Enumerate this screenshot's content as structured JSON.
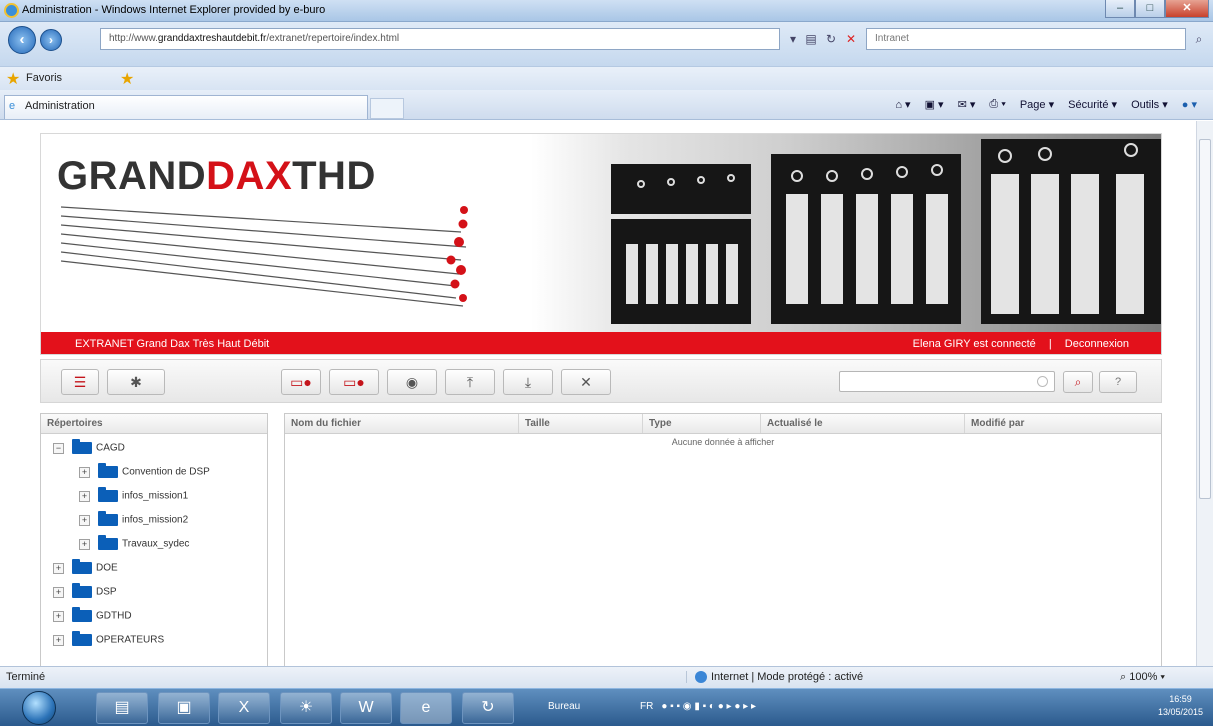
{
  "window": {
    "title": "Administration - Windows Internet Explorer provided by e-buro",
    "controls": [
      "min-icon",
      "max-icon",
      "close-icon"
    ]
  },
  "addressbar": {
    "url_prefix": "http://www.",
    "url_domain": "granddaxtreshautdebit.fr",
    "url_path": "/extranet/repertoire/index.html",
    "search_placeholder": "Intranet"
  },
  "favorites": {
    "label": "Favoris"
  },
  "tab": {
    "title": "Administration"
  },
  "commandbar": {
    "page": "Page ▾",
    "securite": "Sécurité ▾",
    "outils": "Outils ▾"
  },
  "banner": {
    "logo_grand": "GRAND",
    "logo_dax": "DAX",
    "logo_thd": "THD",
    "left_text": "EXTRANET Grand Dax Très Haut Débit",
    "user_text": "Elena GIRY est connecté",
    "separator": "|",
    "logout": "Deconnexion"
  },
  "toolbar": {
    "help_label": "?"
  },
  "tree": {
    "header": "Répertoires",
    "nodes": [
      {
        "label": "CAGD",
        "expander": "−"
      },
      {
        "label": "Convention de DSP",
        "expander": "+"
      },
      {
        "label": "infos_mission1",
        "expander": "+"
      },
      {
        "label": "infos_mission2",
        "expander": "+"
      },
      {
        "label": "Travaux_sydec",
        "expander": "+"
      },
      {
        "label": "DOE",
        "expander": "+"
      },
      {
        "label": "DSP",
        "expander": "+"
      },
      {
        "label": "GDTHD",
        "expander": "+"
      },
      {
        "label": "OPERATEURS",
        "expander": "+"
      }
    ]
  },
  "files": {
    "columns": [
      "Nom du fichier",
      "Taille",
      "Type",
      "Actualisé le",
      "Modifié par"
    ],
    "empty_text": "Aucune donnée à afficher"
  },
  "status": {
    "left": "Terminé",
    "zone": "Internet | Mode protégé : activé",
    "zoom": "100%"
  },
  "taskbar": {
    "bureau": "Bureau",
    "lang": "FR",
    "time": "16:59",
    "date": "13/05/2015"
  },
  "colors": {
    "brand_red": "#e3111b",
    "folder_blue": "#0b5fb8"
  }
}
